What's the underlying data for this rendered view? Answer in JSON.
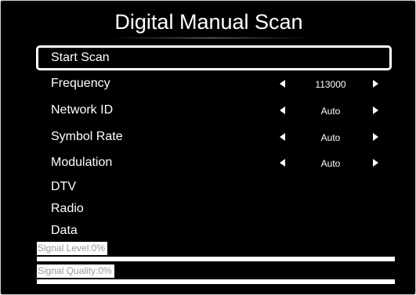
{
  "title": "Digital Manual Scan",
  "menu": {
    "start_scan": "Start Scan",
    "frequency": {
      "label": "Frequency",
      "value": "113000"
    },
    "network_id": {
      "label": "Network ID",
      "value": "Auto"
    },
    "symbol_rate": {
      "label": "Symbol Rate",
      "value": "Auto"
    },
    "modulation": {
      "label": "Modulation",
      "value": "Auto"
    },
    "dtv": "DTV",
    "radio": "Radio",
    "data": "Data"
  },
  "signal": {
    "level_label": "Signal Level:0%",
    "level_percent": 0,
    "quality_label": "Signal Quality:0%",
    "quality_percent": 0
  },
  "colors": {
    "background": "#000000",
    "text": "#ffffff",
    "signal_label_text": "#9a9a9a"
  }
}
